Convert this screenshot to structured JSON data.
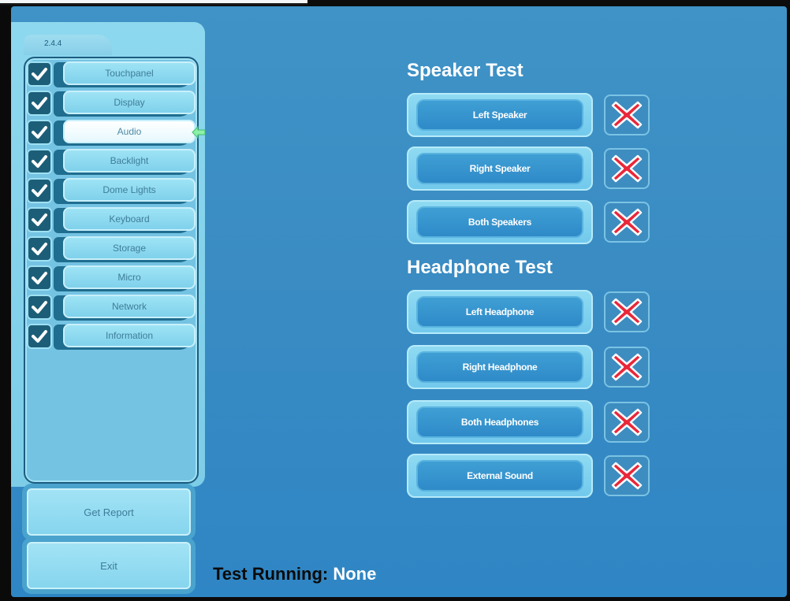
{
  "version": "2.4.4",
  "nav": {
    "items": [
      {
        "label": "Touchpanel",
        "checked": true,
        "active": false
      },
      {
        "label": "Display",
        "checked": true,
        "active": false
      },
      {
        "label": "Audio",
        "checked": true,
        "active": true
      },
      {
        "label": "Backlight",
        "checked": true,
        "active": false
      },
      {
        "label": "Dome Lights",
        "checked": true,
        "active": false
      },
      {
        "label": "Keyboard",
        "checked": true,
        "active": false
      },
      {
        "label": "Storage",
        "checked": true,
        "active": false
      },
      {
        "label": "Micro",
        "checked": true,
        "active": false
      },
      {
        "label": "Network",
        "checked": true,
        "active": false
      },
      {
        "label": "Information",
        "checked": true,
        "active": false
      }
    ]
  },
  "actions": {
    "get_report_label": "Get Report",
    "exit_label": "Exit"
  },
  "speaker_test": {
    "title": "Speaker Test",
    "tests": [
      {
        "label": "Left Speaker",
        "result": "fail"
      },
      {
        "label": "Right Speaker",
        "result": "fail"
      },
      {
        "label": "Both Speakers",
        "result": "fail"
      }
    ]
  },
  "headphone_test": {
    "title": "Headphone Test",
    "tests": [
      {
        "label": "Left Headphone",
        "result": "fail"
      },
      {
        "label": "Right Headphone",
        "result": "fail"
      },
      {
        "label": "Both Headphones",
        "result": "fail"
      },
      {
        "label": "External Sound",
        "result": "fail"
      }
    ]
  },
  "status": {
    "label": "Test Running:",
    "value": "None"
  },
  "colors": {
    "background": "#3a8cc3",
    "panel": "#7dcde8",
    "check_green": "#ffffff",
    "fail_red": "#e8283a"
  },
  "icons": {
    "check": "check-icon",
    "fail": "x-mark-icon",
    "active_indicator": "arrow-left-icon"
  }
}
